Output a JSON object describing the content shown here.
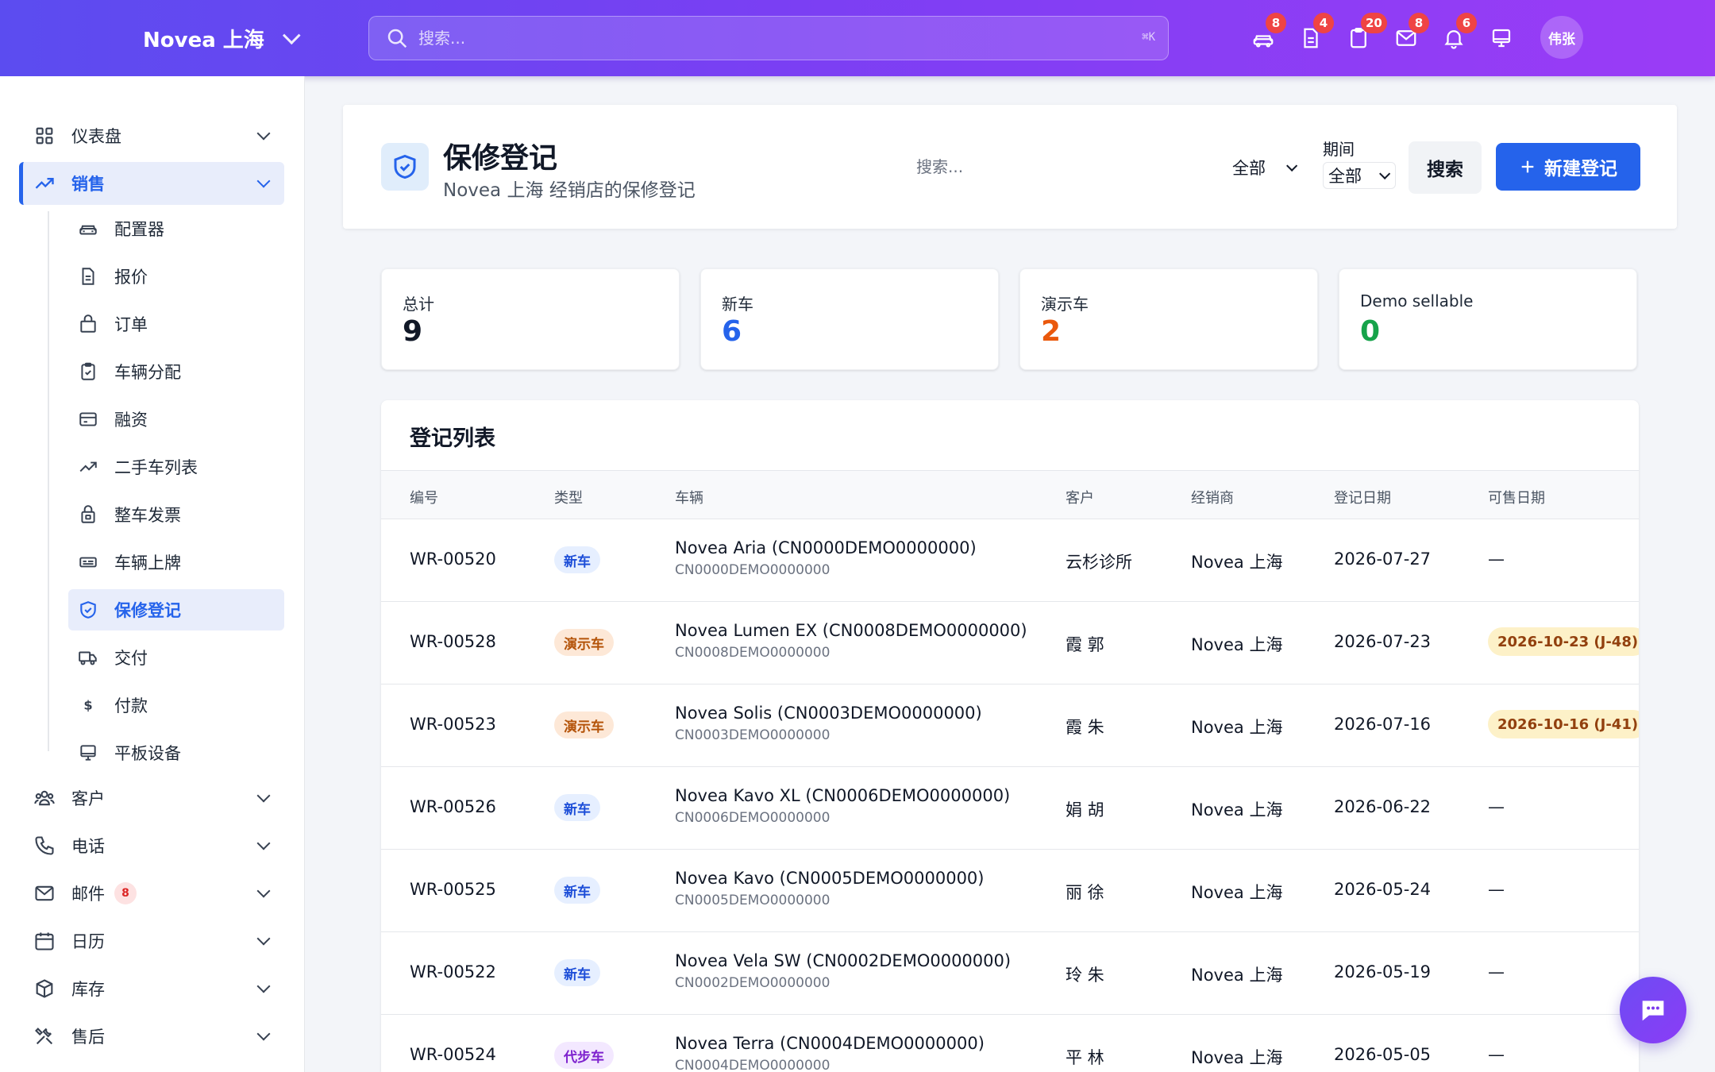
{
  "topbar": {
    "brand": "Novea 上海",
    "search_placeholder": "搜索...",
    "search_shortcut": "⌘K",
    "badges": [
      "8",
      "4",
      "20",
      "8",
      "6"
    ],
    "avatar": "伟张"
  },
  "sidebar": {
    "main_items": [
      {
        "label": "仪表盘",
        "icon": "grid-icon"
      },
      {
        "label": "销售",
        "icon": "trend-icon"
      },
      {
        "label": "客户",
        "icon": "users-icon"
      },
      {
        "label": "电话",
        "icon": "phone-icon"
      },
      {
        "label": "邮件",
        "icon": "mail-icon",
        "badge": "8"
      },
      {
        "label": "日历",
        "icon": "calendar-icon"
      },
      {
        "label": "库存",
        "icon": "box-icon"
      },
      {
        "label": "售后",
        "icon": "tools-icon"
      }
    ],
    "sub_items": [
      {
        "label": "配置器",
        "icon": "car-icon"
      },
      {
        "label": "报价",
        "icon": "document-icon"
      },
      {
        "label": "订单",
        "icon": "bag-icon"
      },
      {
        "label": "车辆分配",
        "icon": "clipboard-icon"
      },
      {
        "label": "融资",
        "icon": "card-icon"
      },
      {
        "label": "二手车列表",
        "icon": "trend-icon"
      },
      {
        "label": "整车发票",
        "icon": "lock-bag-icon"
      },
      {
        "label": "车辆上牌",
        "icon": "plate-icon"
      },
      {
        "label": "保修登记",
        "icon": "shield-icon"
      },
      {
        "label": "交付",
        "icon": "truck-icon"
      },
      {
        "label": "付款",
        "icon": "dollar-icon"
      },
      {
        "label": "平板设备",
        "icon": "monitor-icon"
      }
    ]
  },
  "header": {
    "title": "保修登记",
    "subtitle": "Novea 上海 经销店的保修登记",
    "search_placeholder": "搜索...",
    "filter_value": "全部",
    "period_label": "期间",
    "period_value": "全部",
    "search_button": "搜索",
    "new_button": "新建登记"
  },
  "stats": [
    {
      "label": "总计",
      "value": "9",
      "color": "#111827"
    },
    {
      "label": "新车",
      "value": "6",
      "color": "#2563eb"
    },
    {
      "label": "演示车",
      "value": "2",
      "color": "#ea580c"
    },
    {
      "label": "Demo sellable",
      "value": "0",
      "color": "#16a34a"
    }
  ],
  "table": {
    "title": "登记列表",
    "columns": [
      "编号",
      "类型",
      "车辆",
      "客户",
      "经销商",
      "登记日期",
      "可售日期"
    ],
    "rows": [
      {
        "id": "WR-00520",
        "type": "新车",
        "kind": "new",
        "vehicle": "Novea Aria (CN0000DEMO0000000)",
        "vin": "CN0000DEMO0000000",
        "customer": "云杉诊所",
        "dealer": "Novea 上海",
        "date": "2026-07-27",
        "sellable": "—"
      },
      {
        "id": "WR-00528",
        "type": "演示车",
        "kind": "demo",
        "vehicle": "Novea Lumen EX (CN0008DEMO0000000)",
        "vin": "CN0008DEMO0000000",
        "customer": "霞 郭",
        "dealer": "Novea 上海",
        "date": "2026-07-23",
        "sellable": "2026-10-23 (J-48)"
      },
      {
        "id": "WR-00523",
        "type": "演示车",
        "kind": "demo",
        "vehicle": "Novea Solis (CN0003DEMO0000000)",
        "vin": "CN0003DEMO0000000",
        "customer": "霞 朱",
        "dealer": "Novea 上海",
        "date": "2026-07-16",
        "sellable": "2026-10-16 (J-41)"
      },
      {
        "id": "WR-00526",
        "type": "新车",
        "kind": "new",
        "vehicle": "Novea Kavo XL (CN0006DEMO0000000)",
        "vin": "CN0006DEMO0000000",
        "customer": "娟 胡",
        "dealer": "Novea 上海",
        "date": "2026-06-22",
        "sellable": "—"
      },
      {
        "id": "WR-00525",
        "type": "新车",
        "kind": "new",
        "vehicle": "Novea Kavo (CN0005DEMO0000000)",
        "vin": "CN0005DEMO0000000",
        "customer": "丽 徐",
        "dealer": "Novea 上海",
        "date": "2026-05-24",
        "sellable": "—"
      },
      {
        "id": "WR-00522",
        "type": "新车",
        "kind": "new",
        "vehicle": "Novea Vela SW (CN0002DEMO0000000)",
        "vin": "CN0002DEMO0000000",
        "customer": "玲 朱",
        "dealer": "Novea 上海",
        "date": "2026-05-19",
        "sellable": "—"
      },
      {
        "id": "WR-00524",
        "type": "代步车",
        "kind": "loaner",
        "vehicle": "Novea Terra (CN0004DEMO0000000)",
        "vin": "CN0004DEMO0000000",
        "customer": "平 林",
        "dealer": "Novea 上海",
        "date": "2026-05-05",
        "sellable": "—"
      }
    ]
  }
}
